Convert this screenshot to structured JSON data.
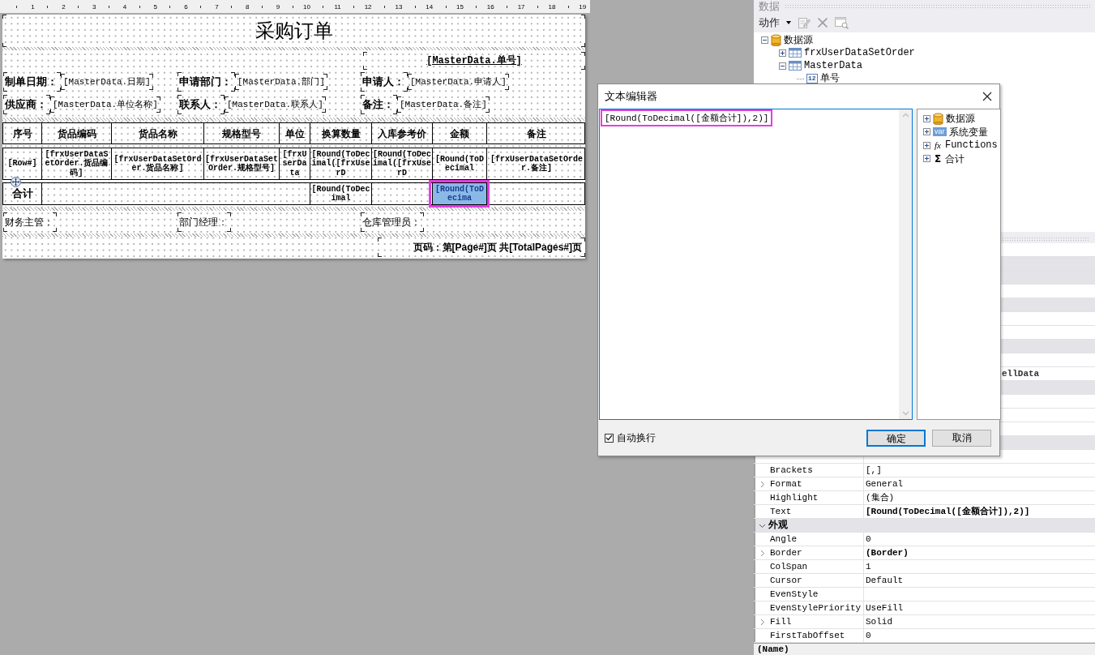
{
  "ruler": [
    "1",
    "2",
    "3",
    "4",
    "5",
    "6",
    "7",
    "8",
    "9",
    "10",
    "11",
    "12",
    "13",
    "14",
    "15",
    "16",
    "17",
    "18",
    "19"
  ],
  "report": {
    "title": "采购订单",
    "order_no": "[MasterData.单号]",
    "info_rows": [
      [
        {
          "label": "制单日期：",
          "field": "[MasterData.日期]"
        },
        {
          "label": "申请部门：",
          "field": "[MasterData.部门]"
        },
        {
          "label": "申请人：",
          "field": "[MasterData.申请人]"
        }
      ],
      [
        {
          "label": "供应商：",
          "field": "[MasterData.单位名称]"
        },
        {
          "label": "联系人：",
          "field": "[MasterData.联系人]"
        },
        {
          "label": "备注：",
          "field": "[MasterData.备注]"
        }
      ]
    ],
    "table": {
      "columns": [
        "序号",
        "货品编码",
        "货品名称",
        "规格型号",
        "单位",
        "换算数量",
        "入库参考价",
        "金额",
        "备注"
      ],
      "data_row": [
        "[Row#]",
        "[frxUserDataSetOrder.货品编码]",
        "[frxUserDataSetOrder.货品名称]",
        "[frxUserDataSetOrder.规格型号]",
        "[frxUserData",
        "[Round(ToDecimal([frxUserD",
        "[Round(ToDecimal([frxUserD",
        "[Round(ToDecimal",
        "[frxUserDataSetOrder.备注]"
      ],
      "total_row": [
        {
          "kind": "label",
          "text": "合计",
          "selected": false,
          "highlighted": false
        },
        {
          "kind": "merged",
          "selected": false,
          "highlighted": false
        },
        {
          "kind": "cell",
          "text": "[Round(ToDecimal",
          "selected": false,
          "highlighted": false
        },
        {
          "kind": "cell",
          "selected": false,
          "highlighted": false
        },
        {
          "kind": "cell",
          "text": "[Round(ToDecima",
          "selected": true,
          "highlighted": true
        },
        {
          "kind": "cell",
          "selected": false,
          "highlighted": false
        }
      ]
    },
    "signatures": [
      "财务主管：",
      "部门经理：",
      "仓库管理员："
    ],
    "page_footer": "页码：第[Page#]页 共[TotalPages#]页"
  },
  "data_panel": {
    "title": "数据",
    "toolbar": {
      "label": "动作"
    },
    "tree": [
      {
        "label": "数据源",
        "kind": "database",
        "expanded": true,
        "children": [
          {
            "label": "frxUserDataSetOrder",
            "kind": "table",
            "expanded": false
          },
          {
            "label": "MasterData",
            "kind": "table",
            "expanded": true,
            "children": [
              {
                "label": "单号",
                "kind": "number",
                "glyph": "12"
              }
            ]
          }
        ]
      }
    ]
  },
  "properties": {
    "rows": [
      {
        "kind": "blank"
      },
      {
        "kind": "band"
      },
      {
        "kind": "band"
      },
      {
        "kind": "blank"
      },
      {
        "kind": "band"
      },
      {
        "kind": "blank"
      },
      {
        "kind": "blank"
      },
      {
        "kind": "band"
      },
      {
        "kind": "blank"
      },
      {
        "kind": "cut",
        "value": "ellData"
      },
      {
        "kind": "band"
      },
      {
        "kind": "blank"
      },
      {
        "kind": "blank"
      },
      {
        "kind": "blank"
      },
      {
        "kind": "band"
      },
      {
        "kind": "blank"
      },
      {
        "kind": "property",
        "name": "Brackets",
        "value": "[,]",
        "modified": false,
        "expandable": false
      },
      {
        "kind": "property",
        "name": "Format",
        "value": "General",
        "modified": false,
        "expandable": true
      },
      {
        "kind": "property",
        "name": "Highlight",
        "value": "(集合)",
        "modified": false,
        "expandable": false
      },
      {
        "kind": "property",
        "name": "Text",
        "value": "[Round(ToDecimal([金额合计]),2)]",
        "modified": true,
        "expandable": false
      },
      {
        "kind": "category",
        "name": "外观",
        "expanded": true
      },
      {
        "kind": "property",
        "name": "Angle",
        "value": "0",
        "modified": false,
        "expandable": false
      },
      {
        "kind": "property",
        "name": "Border",
        "value": "(Border)",
        "modified": true,
        "expandable": true
      },
      {
        "kind": "property",
        "name": "ColSpan",
        "value": "1",
        "modified": false,
        "expandable": false
      },
      {
        "kind": "property",
        "name": "Cursor",
        "value": "Default",
        "modified": false,
        "expandable": false
      },
      {
        "kind": "property",
        "name": "EvenStyle",
        "expandable": false
      },
      {
        "kind": "property",
        "name": "EvenStylePriority",
        "value": "UseFill",
        "modified": false,
        "expandable": false
      },
      {
        "kind": "property",
        "name": "Fill",
        "value": "Solid",
        "modified": false,
        "expandable": true
      },
      {
        "kind": "property",
        "name": "FirstTabOffset",
        "value": "0",
        "modified": false,
        "expandable": false
      }
    ],
    "description": "(Name)"
  },
  "dialog": {
    "title": "文本编辑器",
    "text": "[Round(ToDecimal([金额合计]),2)]",
    "text_highlighted": true,
    "tree": [
      {
        "label": "数据源",
        "kind": "database",
        "expanded": false
      },
      {
        "label": "系统变量",
        "kind": "variable",
        "glyph": "var",
        "expanded": false
      },
      {
        "label": "Functions",
        "kind": "function",
        "glyph": "fx",
        "expanded": false
      },
      {
        "label": "合计",
        "kind": "sum",
        "glyph": "Σ",
        "expanded": false
      }
    ],
    "word_wrap": {
      "label": "自动换行",
      "checked": true
    },
    "buttons": [
      {
        "label": "确定",
        "default": true
      },
      {
        "label": "取消",
        "default": false
      }
    ]
  }
}
